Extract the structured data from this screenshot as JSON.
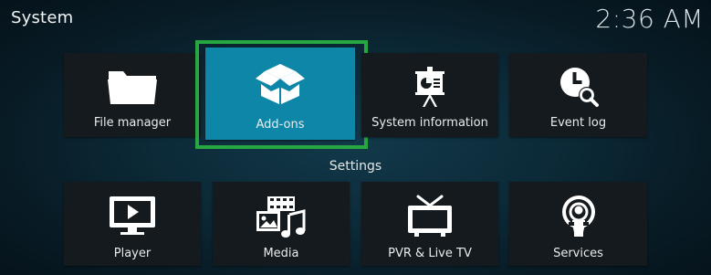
{
  "header": {
    "title": "System",
    "clock": "2:36 AM"
  },
  "main_tiles": [
    {
      "label": "File manager",
      "icon": "folder-icon"
    },
    {
      "label": "Add-ons",
      "icon": "open-box-icon",
      "focused": true
    },
    {
      "label": "System information",
      "icon": "presentation-board-icon"
    },
    {
      "label": "Event log",
      "icon": "clock-search-icon"
    }
  ],
  "settings": {
    "title": "Settings",
    "tiles": [
      {
        "label": "Player",
        "icon": "monitor-play-icon"
      },
      {
        "label": "Media",
        "icon": "media-library-icon"
      },
      {
        "label": "PVR & Live TV",
        "icon": "tv-antenna-icon"
      },
      {
        "label": "Services",
        "icon": "podcast-broadcast-icon"
      }
    ]
  },
  "colors": {
    "focus_border": "#26a741",
    "focused_tile": "#0e86a8",
    "tile": "#141a1e",
    "background": "#0c2a38"
  }
}
